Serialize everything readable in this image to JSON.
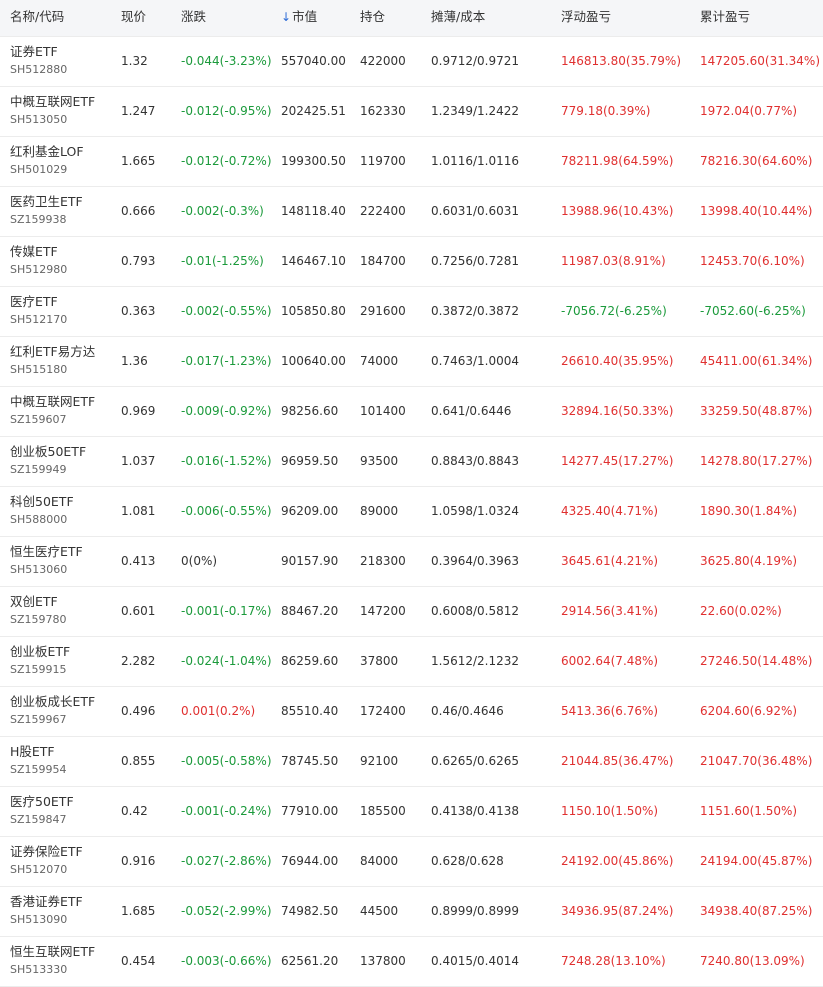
{
  "headers": {
    "name": "名称/代码",
    "price": "现价",
    "change": "涨跌",
    "market_value": "市值",
    "market_value_sort_icon": "↓",
    "holding": "持仓",
    "cost": "摊薄/成本",
    "float_pl": "浮动盈亏",
    "cum_pl": "累计盈亏"
  },
  "colors": {
    "up": "#e03030",
    "down": "#1b9a3b",
    "neutral": "#333333",
    "sort_accent": "#2c6bd6"
  },
  "rows": [
    {
      "name": "证券ETF",
      "code": "SH512880",
      "price": "1.32",
      "change": "-0.044(-3.23%)",
      "market_value": "557040.00",
      "holding": "422000",
      "cost": "0.9712/0.9721",
      "float_pl": "146813.80(35.79%)",
      "cum_pl": "147205.60(31.34%)",
      "change_dir": "down",
      "float_dir": "up",
      "cum_dir": "up"
    },
    {
      "name": "中概互联网ETF",
      "code": "SH513050",
      "price": "1.247",
      "change": "-0.012(-0.95%)",
      "market_value": "202425.51",
      "holding": "162330",
      "cost": "1.2349/1.2422",
      "float_pl": "779.18(0.39%)",
      "cum_pl": "1972.04(0.77%)",
      "change_dir": "down",
      "float_dir": "up",
      "cum_dir": "up"
    },
    {
      "name": "红利基金LOF",
      "code": "SH501029",
      "price": "1.665",
      "change": "-0.012(-0.72%)",
      "market_value": "199300.50",
      "holding": "119700",
      "cost": "1.0116/1.0116",
      "float_pl": "78211.98(64.59%)",
      "cum_pl": "78216.30(64.60%)",
      "change_dir": "down",
      "float_dir": "up",
      "cum_dir": "up"
    },
    {
      "name": "医药卫生ETF",
      "code": "SZ159938",
      "price": "0.666",
      "change": "-0.002(-0.3%)",
      "market_value": "148118.40",
      "holding": "222400",
      "cost": "0.6031/0.6031",
      "float_pl": "13988.96(10.43%)",
      "cum_pl": "13998.40(10.44%)",
      "change_dir": "down",
      "float_dir": "up",
      "cum_dir": "up"
    },
    {
      "name": "传媒ETF",
      "code": "SH512980",
      "price": "0.793",
      "change": "-0.01(-1.25%)",
      "market_value": "146467.10",
      "holding": "184700",
      "cost": "0.7256/0.7281",
      "float_pl": "11987.03(8.91%)",
      "cum_pl": "12453.70(6.10%)",
      "change_dir": "down",
      "float_dir": "up",
      "cum_dir": "up"
    },
    {
      "name": "医疗ETF",
      "code": "SH512170",
      "price": "0.363",
      "change": "-0.002(-0.55%)",
      "market_value": "105850.80",
      "holding": "291600",
      "cost": "0.3872/0.3872",
      "float_pl": "-7056.72(-6.25%)",
      "cum_pl": "-7052.60(-6.25%)",
      "change_dir": "down",
      "float_dir": "down",
      "cum_dir": "down"
    },
    {
      "name": "红利ETF易方达",
      "code": "SH515180",
      "price": "1.36",
      "change": "-0.017(-1.23%)",
      "market_value": "100640.00",
      "holding": "74000",
      "cost": "0.7463/1.0004",
      "float_pl": "26610.40(35.95%)",
      "cum_pl": "45411.00(61.34%)",
      "change_dir": "down",
      "float_dir": "up",
      "cum_dir": "up"
    },
    {
      "name": "中概互联网ETF",
      "code": "SZ159607",
      "price": "0.969",
      "change": "-0.009(-0.92%)",
      "market_value": "98256.60",
      "holding": "101400",
      "cost": "0.641/0.6446",
      "float_pl": "32894.16(50.33%)",
      "cum_pl": "33259.50(48.87%)",
      "change_dir": "down",
      "float_dir": "up",
      "cum_dir": "up"
    },
    {
      "name": "创业板50ETF",
      "code": "SZ159949",
      "price": "1.037",
      "change": "-0.016(-1.52%)",
      "market_value": "96959.50",
      "holding": "93500",
      "cost": "0.8843/0.8843",
      "float_pl": "14277.45(17.27%)",
      "cum_pl": "14278.80(17.27%)",
      "change_dir": "down",
      "float_dir": "up",
      "cum_dir": "up"
    },
    {
      "name": "科创50ETF",
      "code": "SH588000",
      "price": "1.081",
      "change": "-0.006(-0.55%)",
      "market_value": "96209.00",
      "holding": "89000",
      "cost": "1.0598/1.0324",
      "float_pl": "4325.40(4.71%)",
      "cum_pl": "1890.30(1.84%)",
      "change_dir": "down",
      "float_dir": "up",
      "cum_dir": "up"
    },
    {
      "name": "恒生医疗ETF",
      "code": "SH513060",
      "price": "0.413",
      "change": "0(0%)",
      "market_value": "90157.90",
      "holding": "218300",
      "cost": "0.3964/0.3963",
      "float_pl": "3645.61(4.21%)",
      "cum_pl": "3625.80(4.19%)",
      "change_dir": "flat",
      "float_dir": "up",
      "cum_dir": "up"
    },
    {
      "name": "双创ETF",
      "code": "SZ159780",
      "price": "0.601",
      "change": "-0.001(-0.17%)",
      "market_value": "88467.20",
      "holding": "147200",
      "cost": "0.6008/0.5812",
      "float_pl": "2914.56(3.41%)",
      "cum_pl": "22.60(0.02%)",
      "change_dir": "down",
      "float_dir": "up",
      "cum_dir": "up"
    },
    {
      "name": "创业板ETF",
      "code": "SZ159915",
      "price": "2.282",
      "change": "-0.024(-1.04%)",
      "market_value": "86259.60",
      "holding": "37800",
      "cost": "1.5612/2.1232",
      "float_pl": "6002.64(7.48%)",
      "cum_pl": "27246.50(14.48%)",
      "change_dir": "down",
      "float_dir": "up",
      "cum_dir": "up"
    },
    {
      "name": "创业板成长ETF",
      "code": "SZ159967",
      "price": "0.496",
      "change": "0.001(0.2%)",
      "market_value": "85510.40",
      "holding": "172400",
      "cost": "0.46/0.4646",
      "float_pl": "5413.36(6.76%)",
      "cum_pl": "6204.60(6.92%)",
      "change_dir": "up",
      "float_dir": "up",
      "cum_dir": "up"
    },
    {
      "name": "H股ETF",
      "code": "SZ159954",
      "price": "0.855",
      "change": "-0.005(-0.58%)",
      "market_value": "78745.50",
      "holding": "92100",
      "cost": "0.6265/0.6265",
      "float_pl": "21044.85(36.47%)",
      "cum_pl": "21047.70(36.48%)",
      "change_dir": "down",
      "float_dir": "up",
      "cum_dir": "up"
    },
    {
      "name": "医疗50ETF",
      "code": "SZ159847",
      "price": "0.42",
      "change": "-0.001(-0.24%)",
      "market_value": "77910.00",
      "holding": "185500",
      "cost": "0.4138/0.4138",
      "float_pl": "1150.10(1.50%)",
      "cum_pl": "1151.60(1.50%)",
      "change_dir": "down",
      "float_dir": "up",
      "cum_dir": "up"
    },
    {
      "name": "证券保险ETF",
      "code": "SH512070",
      "price": "0.916",
      "change": "-0.027(-2.86%)",
      "market_value": "76944.00",
      "holding": "84000",
      "cost": "0.628/0.628",
      "float_pl": "24192.00(45.86%)",
      "cum_pl": "24194.00(45.87%)",
      "change_dir": "down",
      "float_dir": "up",
      "cum_dir": "up"
    },
    {
      "name": "香港证券ETF",
      "code": "SH513090",
      "price": "1.685",
      "change": "-0.052(-2.99%)",
      "market_value": "74982.50",
      "holding": "44500",
      "cost": "0.8999/0.8999",
      "float_pl": "34936.95(87.24%)",
      "cum_pl": "34938.40(87.25%)",
      "change_dir": "down",
      "float_dir": "up",
      "cum_dir": "up"
    },
    {
      "name": "恒生互联网ETF",
      "code": "SH513330",
      "price": "0.454",
      "change": "-0.003(-0.66%)",
      "market_value": "62561.20",
      "holding": "137800",
      "cost": "0.4015/0.4014",
      "float_pl": "7248.28(13.10%)",
      "cum_pl": "7240.80(13.09%)",
      "change_dir": "down",
      "float_dir": "up",
      "cum_dir": "up"
    }
  ]
}
